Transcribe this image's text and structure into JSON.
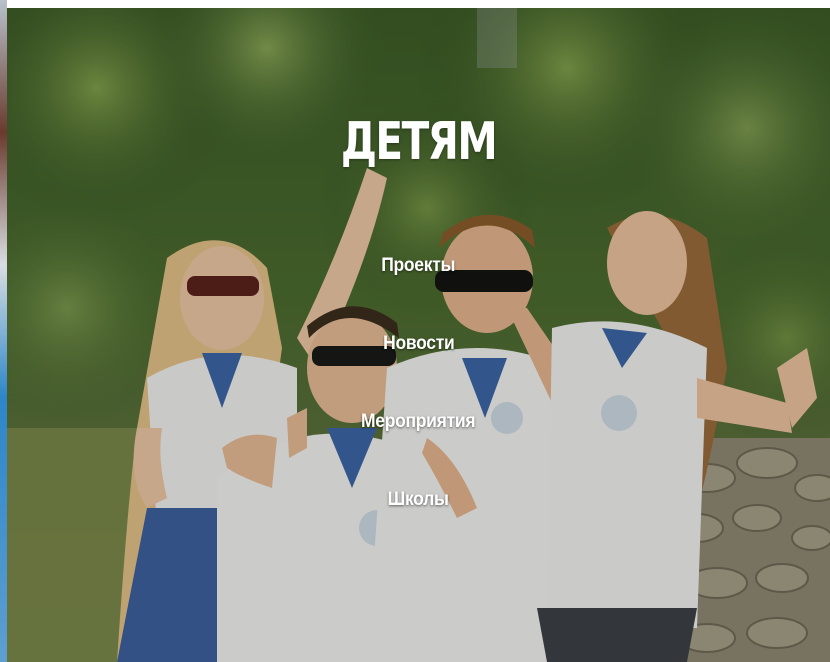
{
  "banner": {
    "title": "ДЕТЯМ",
    "image": "group-of-young-people-thumbs-up-photo"
  },
  "menu": {
    "items": [
      {
        "label": "Проекты"
      },
      {
        "label": "Новости"
      },
      {
        "label": "Мероприятия"
      },
      {
        "label": "Школы"
      }
    ]
  },
  "colors": {
    "text": "#ffffff",
    "foliage": "#3d5a2a",
    "shirt": "#f2f2f2",
    "collar": "#3a63a8",
    "hair": "#e0b97a",
    "stone": "#9a8f7a"
  }
}
